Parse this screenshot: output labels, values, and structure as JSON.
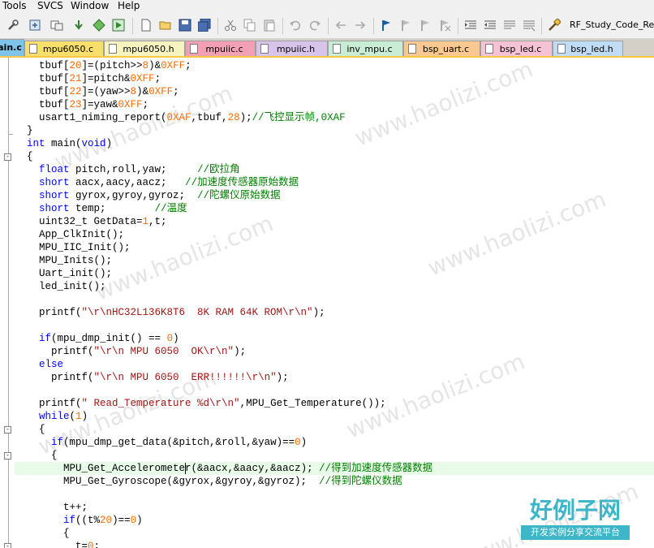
{
  "menu": [
    "Tools",
    "SVCS",
    "Window",
    "Help"
  ],
  "toolbar": {
    "target_name": "RF_Study_Code_Rea"
  },
  "tabs": [
    {
      "label": "ain.c",
      "color": "#7ec3e8",
      "active": true
    },
    {
      "label": "mpu6050.c",
      "color": "#f7df6b"
    },
    {
      "label": "mpu6050.h",
      "color": "#f7f3c0"
    },
    {
      "label": "mpuiic.c",
      "color": "#f4a0b4"
    },
    {
      "label": "mpuiic.h",
      "color": "#d8c4ea"
    },
    {
      "label": "inv_mpu.c",
      "color": "#c8ecd4"
    },
    {
      "label": "bsp_uart.c",
      "color": "#f9c890"
    },
    {
      "label": "bsp_led.c",
      "color": "#f5c2d6"
    },
    {
      "label": "bsp_led.h",
      "color": "#c0dcf4"
    }
  ],
  "editor": {
    "highlight_color": "#e8fbe8",
    "lines": [
      [
        {
          "t": "    tbuf["
        },
        {
          "t": "20",
          "c": "num"
        },
        {
          "t": "]=(pitch>>"
        },
        {
          "t": "8",
          "c": "num"
        },
        {
          "t": ")&"
        },
        {
          "t": "0XFF",
          "c": "num"
        },
        {
          "t": ";"
        }
      ],
      [
        {
          "t": "    tbuf["
        },
        {
          "t": "21",
          "c": "num"
        },
        {
          "t": "]=pitch&"
        },
        {
          "t": "0XFF",
          "c": "num"
        },
        {
          "t": ";"
        }
      ],
      [
        {
          "t": "    tbuf["
        },
        {
          "t": "22",
          "c": "num"
        },
        {
          "t": "]=(yaw>>"
        },
        {
          "t": "8",
          "c": "num"
        },
        {
          "t": ")&"
        },
        {
          "t": "0XFF",
          "c": "num"
        },
        {
          "t": ";"
        }
      ],
      [
        {
          "t": "    tbuf["
        },
        {
          "t": "23",
          "c": "num"
        },
        {
          "t": "]=yaw&"
        },
        {
          "t": "0XFF",
          "c": "num"
        },
        {
          "t": ";"
        }
      ],
      [
        {
          "t": "    usart1_niming_report("
        },
        {
          "t": "0XAF",
          "c": "num"
        },
        {
          "t": ",tbuf,"
        },
        {
          "t": "28",
          "c": "num"
        },
        {
          "t": ");"
        },
        {
          "t": "//飞控显示帧,0XAF",
          "c": "cm"
        }
      ],
      [
        {
          "t": "  }"
        }
      ],
      [
        {
          "t": "  "
        },
        {
          "t": "int",
          "c": "kw"
        },
        {
          "t": " main("
        },
        {
          "t": "void",
          "c": "kw"
        },
        {
          "t": ")"
        }
      ],
      [
        {
          "t": "  {"
        }
      ],
      [
        {
          "t": "    "
        },
        {
          "t": "float",
          "c": "kw"
        },
        {
          "t": " pitch,roll,yaw;     "
        },
        {
          "t": "//欧拉角",
          "c": "cm"
        }
      ],
      [
        {
          "t": "    "
        },
        {
          "t": "short",
          "c": "kw"
        },
        {
          "t": " aacx,aacy,aacz;   "
        },
        {
          "t": "//加速度传感器原始数据",
          "c": "cm"
        }
      ],
      [
        {
          "t": "    "
        },
        {
          "t": "short",
          "c": "kw"
        },
        {
          "t": " gyrox,gyroy,gyroz;  "
        },
        {
          "t": "//陀螺仪原始数据",
          "c": "cm"
        }
      ],
      [
        {
          "t": "    "
        },
        {
          "t": "short",
          "c": "kw"
        },
        {
          "t": " temp;        "
        },
        {
          "t": "//温度",
          "c": "cm"
        }
      ],
      [
        {
          "t": "    uint32_t GetData="
        },
        {
          "t": "1",
          "c": "num"
        },
        {
          "t": ",t;"
        }
      ],
      [
        {
          "t": "    App_ClkInit();"
        }
      ],
      [
        {
          "t": "    MPU_IIC_Init();"
        }
      ],
      [
        {
          "t": "    MPU_Inits();"
        }
      ],
      [
        {
          "t": "    Uart_init();"
        }
      ],
      [
        {
          "t": "    led_init();"
        }
      ],
      [
        {
          "t": ""
        }
      ],
      [
        {
          "t": "    printf("
        },
        {
          "t": "\"\\r\\nHC32L136K8T6  8K RAM 64K ROM\\r\\n\"",
          "c": "str"
        },
        {
          "t": ");"
        }
      ],
      [
        {
          "t": ""
        }
      ],
      [
        {
          "t": "    "
        },
        {
          "t": "if",
          "c": "kw"
        },
        {
          "t": "(mpu_dmp_init() == "
        },
        {
          "t": "0",
          "c": "num"
        },
        {
          "t": ")"
        }
      ],
      [
        {
          "t": "      printf("
        },
        {
          "t": "\"\\r\\n MPU 6050  OK\\r\\n\"",
          "c": "str"
        },
        {
          "t": ");"
        }
      ],
      [
        {
          "t": "    "
        },
        {
          "t": "else",
          "c": "kw"
        }
      ],
      [
        {
          "t": "      printf("
        },
        {
          "t": "\"\\r\\n MPU 6050  ERR!!!!!!\\r\\n\"",
          "c": "str"
        },
        {
          "t": ");"
        }
      ],
      [
        {
          "t": ""
        }
      ],
      [
        {
          "t": "    printf("
        },
        {
          "t": "\" Read_Temperature %d\\r\\n\"",
          "c": "str"
        },
        {
          "t": ",MPU_Get_Temperature());"
        }
      ],
      [
        {
          "t": "    "
        },
        {
          "t": "while",
          "c": "kw"
        },
        {
          "t": "("
        },
        {
          "t": "1",
          "c": "num"
        },
        {
          "t": ")"
        }
      ],
      [
        {
          "t": "    {"
        }
      ],
      [
        {
          "t": "      "
        },
        {
          "t": "if",
          "c": "kw"
        },
        {
          "t": "(mpu_dmp_get_data(&pitch,&roll,&yaw)=="
        },
        {
          "t": "0",
          "c": "num"
        },
        {
          "t": ")"
        }
      ],
      [
        {
          "t": "      {"
        }
      ],
      [
        {
          "t": "        MPU_Get_Acceleromete"
        },
        {
          "caret": true
        },
        {
          "t": "r(&aacx,&aacy,&aacz); "
        },
        {
          "t": "//得到加速度传感器数据",
          "c": "cm"
        }
      ],
      [
        {
          "t": "        MPU_Get_Gyroscope(&gyrox,&gyroy,&gyroz);  "
        },
        {
          "t": "//得到陀螺仪数据",
          "c": "cm"
        }
      ],
      [
        {
          "t": ""
        }
      ],
      [
        {
          "t": "        t++;"
        }
      ],
      [
        {
          "t": "        "
        },
        {
          "t": "if",
          "c": "kw"
        },
        {
          "t": "((t%"
        },
        {
          "t": "20",
          "c": "num"
        },
        {
          "t": ")=="
        },
        {
          "t": "0",
          "c": "num"
        },
        {
          "t": ")"
        }
      ],
      [
        {
          "t": "        {"
        }
      ],
      [
        {
          "t": "          t="
        },
        {
          "t": "0",
          "c": "num"
        },
        {
          "t": ";"
        }
      ]
    ]
  },
  "watermark": "www.haolizi.com",
  "logo": {
    "main": "好例子网",
    "sub": "开发实例分享交流平台"
  }
}
